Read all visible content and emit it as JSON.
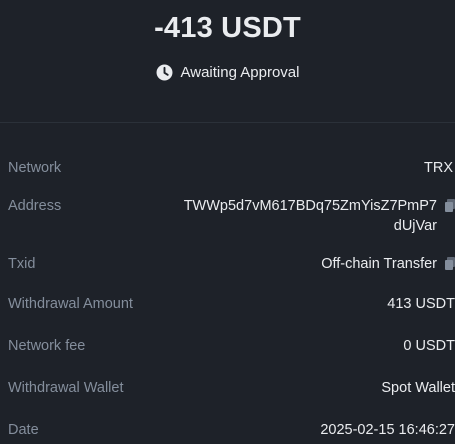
{
  "header": {
    "amount": "-413 USDT",
    "status": "Awaiting Approval",
    "status_icon": "clock-icon"
  },
  "details": {
    "network": {
      "label": "Network",
      "value": "TRX"
    },
    "address": {
      "label": "Address",
      "value_line1": "TWWp5d7vM617BDq75ZmYisZ7PmP7",
      "value_line2": "dUjVar"
    },
    "txid": {
      "label": "Txid",
      "value": "Off-chain Transfer"
    },
    "withdrawal_amount": {
      "label": "Withdrawal Amount",
      "value": "413 USDT"
    },
    "network_fee": {
      "label": "Network fee",
      "value": "0 USDT"
    },
    "withdrawal_wallet": {
      "label": "Withdrawal Wallet",
      "value": "Spot Wallet"
    },
    "date": {
      "label": "Date",
      "value": "2025-02-15 16:46:27"
    }
  },
  "colors": {
    "background": "#1e2229",
    "primary_text": "#eaecef",
    "secondary_text": "#848e9c"
  }
}
